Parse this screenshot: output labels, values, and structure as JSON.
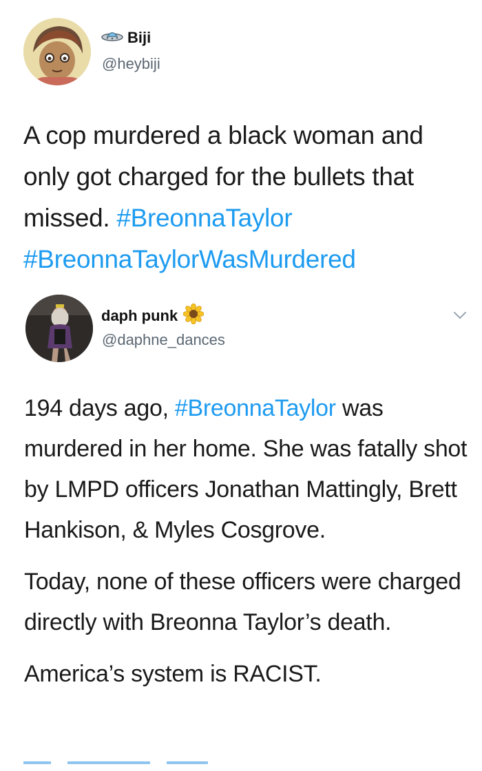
{
  "tweet1": {
    "display_name": "Biji",
    "name_emoji_icon": "flying-saucer-icon",
    "handle": "@heybiji",
    "text_plain": "A cop murdered a black woman and only got charged for the bullets that missed.",
    "hashtag_1": "#BreonnaTaylor",
    "hashtag_2": "#BreonnaTaylorWasMurdered"
  },
  "tweet2": {
    "display_name": "daph punk",
    "name_emoji_icon": "sunflower-icon",
    "handle": "@daphne_dances",
    "more_icon": "chevron-down-icon",
    "p1_before": "194 days ago, ",
    "p1_hashtag": "#BreonnaTaylor",
    "p1_after": " was murdered in her home. She was fatally shot by LMPD officers Jonathan Mattingly, Brett Hankison, & Myles Cosgrove.",
    "p2": "Today, none of these officers were charged directly with Breonna Taylor’s death.",
    "p3": "America’s system is RACIST."
  },
  "colors": {
    "link": "#1d9bf0",
    "text": "#1a1a1a",
    "secondary": "#5b6773"
  }
}
